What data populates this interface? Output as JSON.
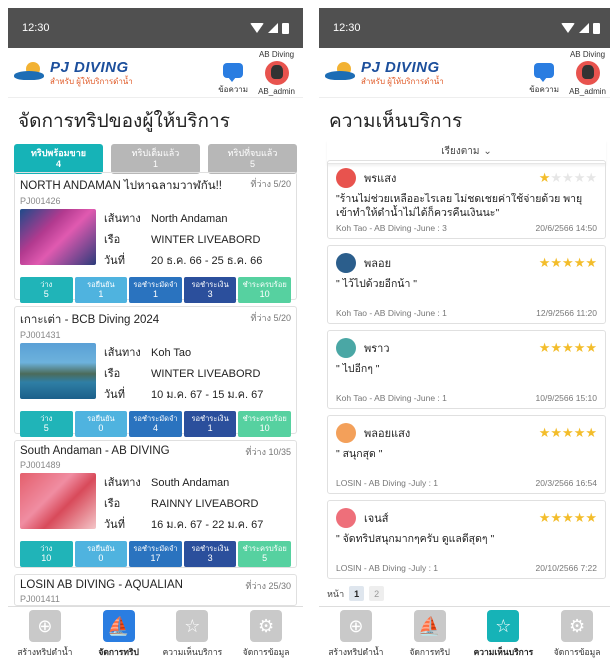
{
  "status_time": "12:30",
  "brand": {
    "title": "PJ DIVING",
    "subtitle": "สำหรับ ผู้ให้บริการดำน้ำ"
  },
  "header": {
    "messages_label": "ข้อความ",
    "user_shop": "AB Diving",
    "user_name": "AB_admin"
  },
  "left": {
    "title": "จัดการทริปของผู้ให้บริการ",
    "segments": [
      {
        "label": "ทริปพร้อมขาย",
        "count": "4"
      },
      {
        "label": "ทริปเต็มแล้ว",
        "count": "1"
      },
      {
        "label": "ทริปที่จบแล้ว",
        "count": "5"
      }
    ],
    "labels": {
      "route": "เส้นทาง",
      "boat": "เรือ",
      "date": "วันที่"
    },
    "stat_labels": [
      "ว่าง",
      "รอยืนยัน",
      "รอชำระมัดจำ",
      "รอชำระเงิน",
      "ชำระครบร้อย"
    ],
    "trips": [
      {
        "name": "NORTH ANDAMAN ไปหาฉลามวาฬกัน!!",
        "free": "ที่ว่าง 5/20",
        "code": "PJ001426",
        "route": "North Andaman",
        "boat": "WINTER LIVEABORD",
        "date": "20 ธ.ค. 66 - 25 ธ.ค. 66",
        "stats": [
          "5",
          "1",
          "1",
          "3",
          "10"
        ]
      },
      {
        "name": "เกาะเต่า - BCB Diving 2024",
        "free": "ที่ว่าง 5/20",
        "code": "PJ001431",
        "route": "Koh Tao",
        "boat": "WINTER LIVEABORD",
        "date": "10 ม.ค. 67 - 15 ม.ค. 67",
        "stats": [
          "5",
          "0",
          "4",
          "1",
          "10"
        ]
      },
      {
        "name": "South Andaman - AB DIVING",
        "free": "ที่ว่าง 10/35",
        "code": "PJ001489",
        "route": "South Andaman",
        "boat": "RAINNY LIVEABORD",
        "date": "16 ม.ค. 67 - 22 ม.ค. 67",
        "stats": [
          "10",
          "0",
          "17",
          "3",
          "5"
        ]
      },
      {
        "name": "LOSIN  AB DIVING - AQUALIAN",
        "free": "ที่ว่าง 25/30",
        "code": "PJ001411"
      }
    ]
  },
  "right": {
    "title": "ความเห็นบริการ",
    "sort_label": "เรียงตาม",
    "pager_label": "หน้า",
    "pages": [
      "1",
      "2"
    ],
    "reviews": [
      {
        "name": "พรแสง",
        "stars": 1,
        "avatar_color": "#e8534e",
        "text": "\"ร้านไม่ช่วยเหลืออะไรเลย ไม่ชดเชยค่าใช้จ่ายด้วย พายุเข้าทำให้ดำน้ำไม่ได้ก็ควรคืนเงินนะ\"",
        "trip": "Koh Tao - AB Diving -June : 3",
        "datetime": "20/6/2566 14:50"
      },
      {
        "name": "พลอย",
        "stars": 5,
        "avatar_color": "#2b5e8c",
        "text": "\" ไว้ไปด้วยอีกน้า \"",
        "trip": "Koh Tao - AB Diving -June : 1",
        "datetime": "12/9/2566 11:20"
      },
      {
        "name": "พราว",
        "stars": 5,
        "avatar_color": "#4aa7a5",
        "text": "\" ไปอีกๆ \"",
        "trip": "Koh Tao - AB Diving -June : 1",
        "datetime": "10/9/2566 15:10"
      },
      {
        "name": "พลอยแสง",
        "stars": 5,
        "avatar_color": "#f3a05a",
        "text": "\" สนุกสุด \"",
        "trip": "LOSIN - AB Diving -July : 1",
        "datetime": "20/3/2566 16:54"
      },
      {
        "name": "เจนส์",
        "stars": 5,
        "avatar_color": "#ee6f7a",
        "text": "\" จัดทริปสนุกมากๆครับ ดูแลดีสุดๆ \"",
        "trip": "LOSIN - AB Diving -July : 1",
        "datetime": "20/10/2566 7:22"
      }
    ]
  },
  "nav": [
    "สร้างทริปดำน้ำ",
    "จัดการทริป",
    "ความเห็นบริการ",
    "จัดการข้อมูล"
  ],
  "colors": {
    "accent": "#16b3b7",
    "nav_active": "#2a7de1",
    "star": "#f3bd2b"
  }
}
